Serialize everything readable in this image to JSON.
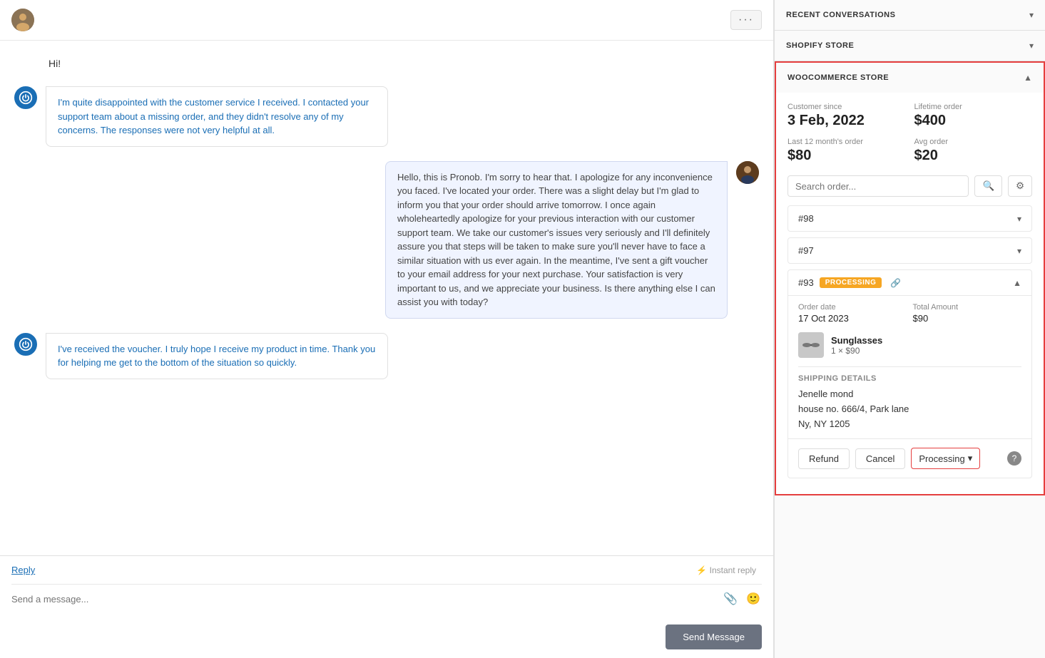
{
  "header": {
    "more_label": "···"
  },
  "chat": {
    "greeting": "Hi!",
    "messages": [
      {
        "id": "msg1",
        "type": "customer",
        "text": "I'm quite disappointed with the customer service I received. I contacted your support team about a missing order, and they didn't resolve any of my concerns. The responses were not very helpful at all."
      },
      {
        "id": "msg2",
        "type": "agent",
        "text": "Hello, this is Pronob. I'm sorry to hear that. I apologize for any inconvenience you faced. I've located your order. There was a slight delay but I'm glad to inform you that your order should arrive tomorrow. I once again wholeheartedly apologize for your previous interaction with our customer support team. We take our customer's issues very seriously and I'll definitely assure you that steps will be taken to make sure you'll never have to face a similar situation with us ever again. In the meantime, I've sent a gift voucher to your email address for your next purchase. Your satisfaction is very important to us, and we appreciate your business. Is there anything else I can assist you with today?"
      },
      {
        "id": "msg3",
        "type": "customer",
        "text": "I've received the voucher. I truly hope I receive my product in time. Thank you for helping me get to the bottom of the situation so quickly."
      }
    ],
    "reply_link": "Reply",
    "input_placeholder": "Send a message...",
    "instant_reply": "⚡ Instant reply",
    "send_button": "Send Message"
  },
  "sidebar": {
    "recent_conversations": {
      "title": "RECENT CONVERSATIONS",
      "expanded": false
    },
    "shopify_store": {
      "title": "SHOPIFY STORE",
      "expanded": false
    },
    "woocommerce_store": {
      "title": "WOOCOMMERCE STORE",
      "expanded": true,
      "customer_since_label": "Customer since",
      "customer_since_value": "3 Feb, 2022",
      "lifetime_order_label": "Lifetime order",
      "lifetime_order_value": "$400",
      "last12_label": "Last 12 month's order",
      "last12_value": "$80",
      "avg_order_label": "Avg order",
      "avg_order_value": "$20",
      "search_placeholder": "Search order...",
      "orders": [
        {
          "id": "#98",
          "expanded": false,
          "status": null
        },
        {
          "id": "#97",
          "expanded": false,
          "status": null
        },
        {
          "id": "#93",
          "expanded": true,
          "status": "PROCESSING",
          "order_date_label": "Order date",
          "order_date_value": "17 Oct 2023",
          "total_label": "Total Amount",
          "total_value": "$90",
          "product_name": "Sunglasses",
          "product_qty": "1 × $90",
          "shipping_title": "SHIPPING DETAILS",
          "shipping_name": "Jenelle mond",
          "shipping_address1": "house no. 666/4, Park lane",
          "shipping_address2": "Ny, NY 1205",
          "btn_refund": "Refund",
          "btn_cancel": "Cancel",
          "btn_status": "Processing",
          "btn_chevron": "▾"
        }
      ]
    }
  }
}
